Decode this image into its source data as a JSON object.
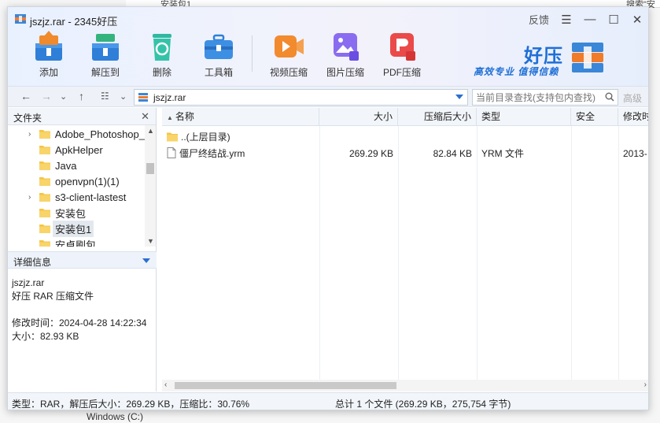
{
  "background": {
    "top_text": "安装包1",
    "top_right_text": "搜索\"安装",
    "bottom_text": "Windows (C:)"
  },
  "window": {
    "title": "jszjz.rar - 2345好压",
    "feedback_label": "反馈",
    "menu_glyph": "☰",
    "minimize_glyph": "—",
    "maximize_glyph": "☐",
    "close_glyph": "✕"
  },
  "toolbar": {
    "add": "添加",
    "extract_to": "解压到",
    "delete": "删除",
    "toolbox": "工具箱",
    "video_compress": "视频压缩",
    "image_compress": "图片压缩",
    "pdf_compress": "PDF压缩"
  },
  "brand": {
    "name": "好压",
    "slogan": "高效专业  值得信赖"
  },
  "address": {
    "path": "jszjz.rar",
    "search_placeholder": "当前目录查找(支持包内查找)",
    "advanced": "高级"
  },
  "left_pane": {
    "folders_label": "文件夹",
    "close_glyph": "✕",
    "tree": [
      {
        "name": "Adobe_Photoshop_",
        "expandable": true
      },
      {
        "name": "ApkHelper",
        "expandable": false
      },
      {
        "name": "Java",
        "expandable": false
      },
      {
        "name": "openvpn(1)(1)",
        "expandable": false
      },
      {
        "name": "s3-client-lastest",
        "expandable": true
      },
      {
        "name": "安装包",
        "expandable": false
      },
      {
        "name": "安装包1",
        "expandable": false,
        "selected": true
      },
      {
        "name": "安卓刷包",
        "expandable": false
      }
    ],
    "details_label": "详细信息",
    "details": {
      "filename": "jszjz.rar",
      "filetype": "好压 RAR 压缩文件",
      "modified": "修改时间：2024-04-28 14:22:34",
      "size": "大小：82.93 KB"
    }
  },
  "file_list": {
    "columns": {
      "name": "名称",
      "size": "大小",
      "packed": "压缩后大小",
      "type": "类型",
      "security": "安全",
      "modified": "修改时"
    },
    "sort_indicator": "▲",
    "rows": [
      {
        "name": "..(上层目录)",
        "size": "",
        "packed": "",
        "type": "",
        "security": "",
        "modified": "",
        "is_folder": true
      },
      {
        "name": "僵尸终结战.yrm",
        "size": "269.29 KB",
        "packed": "82.84 KB",
        "type": "YRM 文件",
        "security": "",
        "modified": "2013-",
        "is_folder": false
      }
    ]
  },
  "status": {
    "left": "类型：RAR，解压后大小：269.29 KB，压缩比：30.76%",
    "right": "总计 1 个文件 (269.29 KB，275,754 字节)"
  },
  "colors": {
    "accent": "#2a6fd1",
    "folder": "#f5c542",
    "title_gradient_start": "#e9f1ff"
  }
}
